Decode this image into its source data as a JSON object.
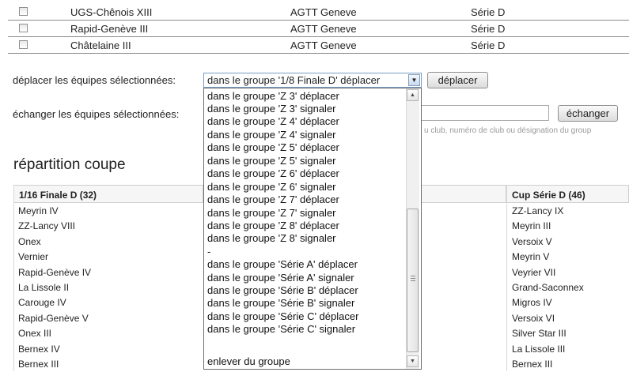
{
  "teams": [
    {
      "name": "UGS-Chênois XIII",
      "association": "AGTT Geneve",
      "series": "Série D"
    },
    {
      "name": "Rapid-Genève III",
      "association": "AGTT Geneve",
      "series": "Série D"
    },
    {
      "name": "Châtelaine III",
      "association": "AGTT Geneve",
      "series": "Série D"
    }
  ],
  "move": {
    "label": "déplacer les équipes sélectionnées:",
    "selected_value": "dans le groupe '1/8 Finale D' déplacer",
    "button_label": "déplacer"
  },
  "swap": {
    "label": "échanger les équipes sélectionnées:",
    "button_label": "échanger",
    "hint": "u club, numéro de club ou désignation du group"
  },
  "section_title": "répartition coupe",
  "groups": [
    {
      "title": "1/16 Finale D (32)",
      "teams": [
        "Meyrin IV",
        "ZZ-Lancy VIII",
        "Onex",
        "Vernier",
        "Rapid-Genève IV",
        "La Lissole II",
        "Carouge IV",
        "Rapid-Genève V",
        "Onex III",
        "Bernex IV",
        "Bernex III"
      ]
    },
    {
      "title": "Cup Série D (46)",
      "teams": [
        "ZZ-Lancy IX",
        "Meyrin III",
        "Versoix V",
        "Meyrin V",
        "Veyrier VII",
        "Grand-Saconnex",
        "Migros IV",
        "Versoix VI",
        "Silver Star III",
        "La Lissole III",
        "Bernex III"
      ]
    }
  ],
  "dropdown_options": [
    "dans le groupe 'Z 3' déplacer",
    "dans le groupe 'Z 3' signaler",
    "dans le groupe 'Z 4' déplacer",
    "dans le groupe 'Z 4' signaler",
    "dans le groupe 'Z 5' déplacer",
    "dans le groupe 'Z 5' signaler",
    "dans le groupe 'Z 6' déplacer",
    "dans le groupe 'Z 6' signaler",
    "dans le groupe 'Z 7' déplacer",
    "dans le groupe 'Z 7' signaler",
    "dans le groupe 'Z 8' déplacer",
    "dans le groupe 'Z 8' signaler",
    "-",
    "dans le groupe 'Série A' déplacer",
    "dans le groupe 'Série A' signaler",
    "dans le groupe 'Série B' déplacer",
    "dans le groupe 'Série B' signaler",
    "dans le groupe 'Série C' déplacer",
    "dans le groupe 'Série C' signaler",
    "enlever du groupe"
  ],
  "icons": {
    "select_arrow": "chevron-down-icon",
    "scroll_up": "scroll-up-icon",
    "scroll_down": "scroll-down-icon"
  }
}
